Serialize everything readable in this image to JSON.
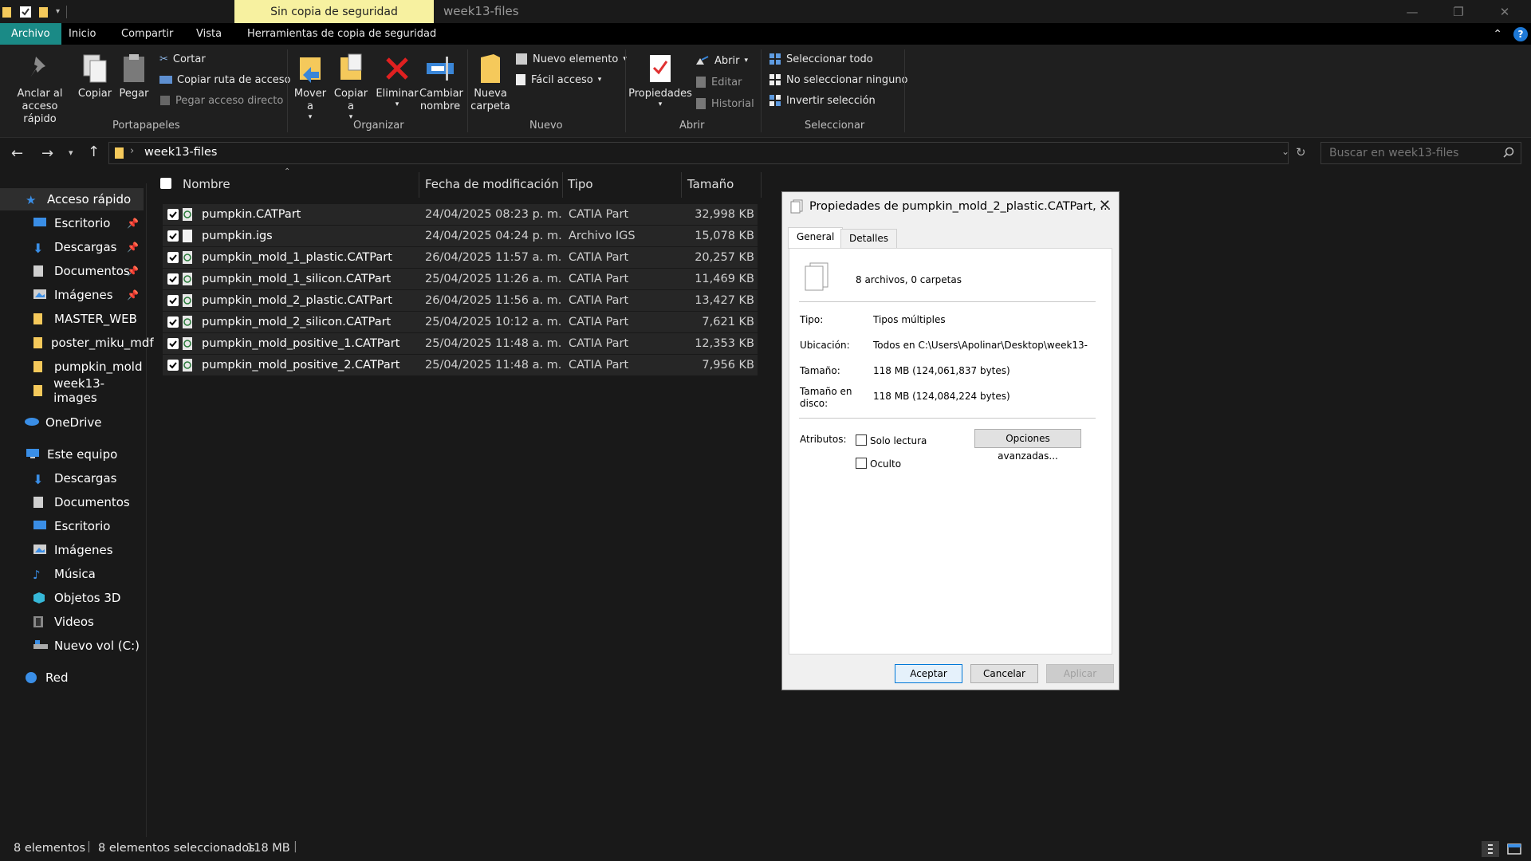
{
  "window": {
    "context_tab": "Sin copia de seguridad",
    "title": "week13-files"
  },
  "ribbon_tabs": [
    {
      "label": "Archivo",
      "active": true
    },
    {
      "label": "Inicio",
      "active": false
    },
    {
      "label": "Compartir",
      "active": false
    },
    {
      "label": "Vista",
      "active": false
    },
    {
      "label": "Herramientas de copia de seguridad",
      "active": false
    }
  ],
  "ribbon": {
    "portapapeles": {
      "anclar": "Anclar al acceso rápido",
      "copiar": "Copiar",
      "pegar": "Pegar",
      "cortar": "Cortar",
      "copiar_ruta": "Copiar ruta de acceso",
      "pegar_acceso": "Pegar acceso directo",
      "group": "Portapapeles"
    },
    "organizar": {
      "mover": "Mover a",
      "copiar": "Copiar a",
      "eliminar": "Eliminar",
      "cambiar": "Cambiar nombre",
      "group": "Organizar"
    },
    "nuevo": {
      "carpeta": "Nueva carpeta",
      "elemento": "Nuevo elemento",
      "facil": "Fácil acceso",
      "group": "Nuevo"
    },
    "abrir": {
      "propiedades": "Propiedades",
      "abrir": "Abrir",
      "editar": "Editar",
      "historial": "Historial",
      "group": "Abrir"
    },
    "seleccionar": {
      "todo": "Seleccionar todo",
      "ninguno": "No seleccionar ninguno",
      "invertir": "Invertir selección",
      "group": "Seleccionar"
    }
  },
  "address": {
    "path": "week13-files",
    "search_placeholder": "Buscar en week13-files"
  },
  "sidebar": {
    "quick_access": "Acceso rápido",
    "quick_items": [
      "Escritorio",
      "Descargas",
      "Documentos",
      "Imágenes",
      "MASTER_WEB",
      "poster_miku_mdf",
      "pumpkin_mold",
      "week13-images"
    ],
    "onedrive": "OneDrive",
    "this_pc": "Este equipo",
    "pc_items": [
      "Descargas",
      "Documentos",
      "Escritorio",
      "Imágenes",
      "Música",
      "Objetos 3D",
      "Videos",
      "Nuevo vol (C:)"
    ],
    "network": "Red"
  },
  "columns": {
    "name": "Nombre",
    "date": "Fecha de modificación",
    "type": "Tipo",
    "size": "Tamaño"
  },
  "files": [
    {
      "name": "pumpkin.CATPart",
      "date": "24/04/2025 08:23 p. m.",
      "type": "CATIA Part",
      "size": "32,998 KB"
    },
    {
      "name": "pumpkin.igs",
      "date": "24/04/2025 04:24 p. m.",
      "type": "Archivo IGS",
      "size": "15,078 KB"
    },
    {
      "name": "pumpkin_mold_1_plastic.CATPart",
      "date": "26/04/2025 11:57 a. m.",
      "type": "CATIA Part",
      "size": "20,257 KB"
    },
    {
      "name": "pumpkin_mold_1_silicon.CATPart",
      "date": "25/04/2025 11:26 a. m.",
      "type": "CATIA Part",
      "size": "11,469 KB"
    },
    {
      "name": "pumpkin_mold_2_plastic.CATPart",
      "date": "26/04/2025 11:56 a. m.",
      "type": "CATIA Part",
      "size": "13,427 KB"
    },
    {
      "name": "pumpkin_mold_2_silicon.CATPart",
      "date": "25/04/2025 10:12 a. m.",
      "type": "CATIA Part",
      "size": "7,621 KB"
    },
    {
      "name": "pumpkin_mold_positive_1.CATPart",
      "date": "25/04/2025 11:48 a. m.",
      "type": "CATIA Part",
      "size": "12,353 KB"
    },
    {
      "name": "pumpkin_mold_positive_2.CATPart",
      "date": "25/04/2025 11:48 a. m.",
      "type": "CATIA Part",
      "size": "7,956 KB"
    }
  ],
  "dialog": {
    "title": "Propiedades de pumpkin_mold_2_plastic.CATPart, ...",
    "tabs": [
      "General",
      "Detalles"
    ],
    "summary": "8 archivos, 0 carpetas",
    "tipo_label": "Tipo:",
    "tipo": "Tipos múltiples",
    "ubicacion_label": "Ubicación:",
    "ubicacion": "Todos en C:\\Users\\Apolinar\\Desktop\\week13-",
    "tamano_label": "Tamaño:",
    "tamano": "118 MB (124,061,837 bytes)",
    "disco_label_1": "Tamaño en",
    "disco_label_2": "disco:",
    "disco": "118 MB (124,084,224 bytes)",
    "atributos_label": "Atributos:",
    "solo_lectura": "Solo lectura",
    "oculto": "Oculto",
    "avanzadas": "Opciones avanzadas...",
    "aceptar": "Aceptar",
    "cancelar": "Cancelar",
    "aplicar": "Aplicar"
  },
  "status": {
    "count": "8 elementos",
    "selected": "8 elementos seleccionados",
    "size": "118 MB"
  },
  "colors": {
    "accent": "#1a8a86",
    "context_tab": "#f7f1a0",
    "folder": "#f5c95b"
  }
}
